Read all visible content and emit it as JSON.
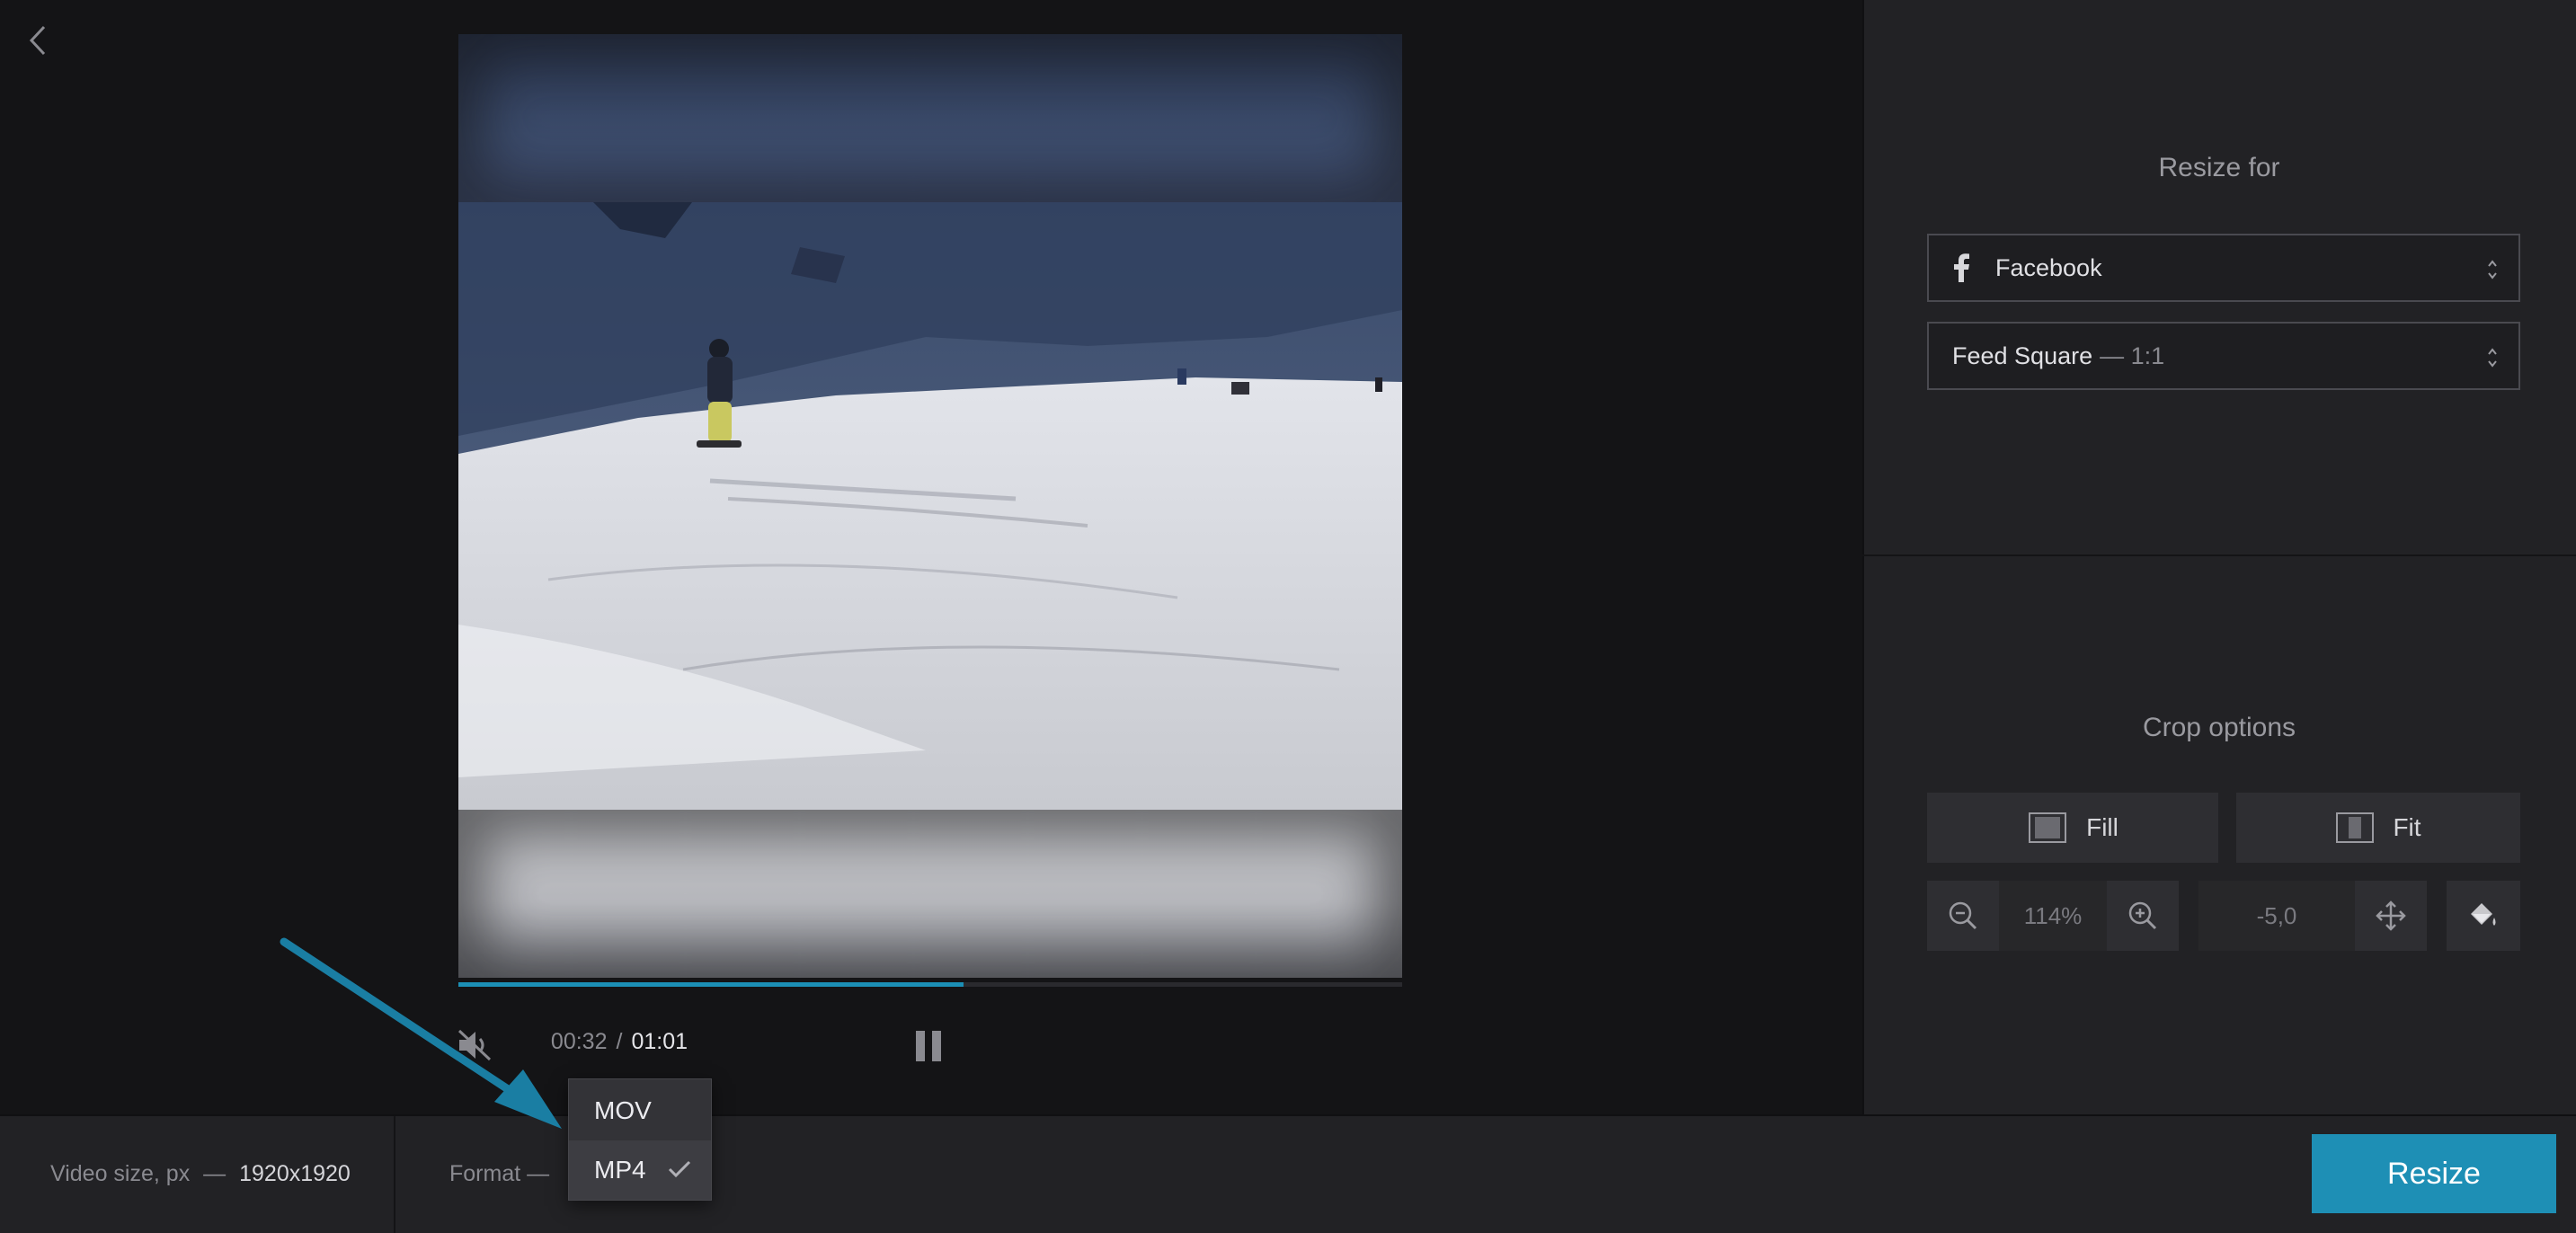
{
  "player": {
    "progress_fraction": 0.535,
    "current_time": "00:32",
    "separator": "/",
    "total_time": "01:01",
    "muted": true,
    "playing": true
  },
  "panel": {
    "resize_heading": "Resize for",
    "platform": "Facebook",
    "preset": "Feed Square",
    "preset_suffix": "— 1:1",
    "crop_heading": "Crop options",
    "fill_label": "Fill",
    "fit_label": "Fit",
    "zoom_value": "114%",
    "position_value": "-5,0"
  },
  "bottom": {
    "video_size_label": "Video size, px",
    "video_size_sep": "—",
    "video_size_value": "1920x1920",
    "format_label": "Format —",
    "resize_button": "Resize"
  },
  "format_menu": {
    "options": [
      "MOV",
      "MP4"
    ],
    "selected": "MP4"
  },
  "colors": {
    "accent": "#1e8fb5",
    "background": "#141416",
    "panel": "#222225"
  },
  "icons": [
    "chevron-left-icon",
    "muted-speaker-icon",
    "pause-icon",
    "facebook-icon",
    "select-arrows-icon",
    "fill-icon",
    "fit-icon",
    "zoom-out-icon",
    "zoom-in-icon",
    "move-icon",
    "paint-bucket-icon",
    "check-icon"
  ]
}
